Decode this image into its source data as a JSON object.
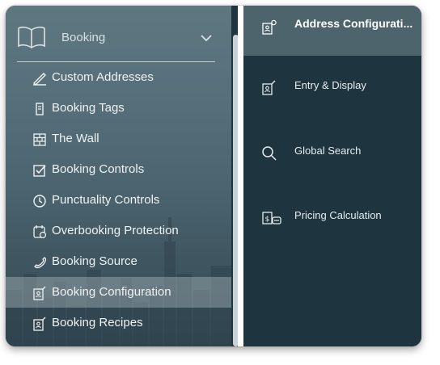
{
  "colors": {
    "left_panel": "#566e79",
    "right_panel": "#1e3540",
    "active_left": "#8fa0a8",
    "active_right": "#4d646d",
    "text": "#eef2f3"
  },
  "left_panel": {
    "header": {
      "title": "Booking",
      "icon": "book-open-icon",
      "toggle_icon": "chevron-down-icon"
    },
    "items": [
      {
        "label": "Custom Addresses",
        "icon": "pen-edit-icon"
      },
      {
        "label": "Booking Tags",
        "icon": "tag-icon"
      },
      {
        "label": "The Wall",
        "icon": "brick-wall-icon"
      },
      {
        "label": "Booking Controls",
        "icon": "checkbox-icon"
      },
      {
        "label": "Punctuality Controls",
        "icon": "clock-icon"
      },
      {
        "label": "Overbooking Protection",
        "icon": "calendar-clock-icon"
      },
      {
        "label": "Booking Source",
        "icon": "phone-icon"
      },
      {
        "label": "Booking Configuration",
        "icon": "config-doc-icon",
        "active": true
      },
      {
        "label": "Booking Recipes",
        "icon": "recipe-doc-icon"
      }
    ]
  },
  "right_panel": {
    "items": [
      {
        "label": "Address Configurati...",
        "icon": "address-config-icon",
        "active": true
      },
      {
        "label": "Entry & Display",
        "icon": "entry-display-icon"
      },
      {
        "label": "Global Search",
        "icon": "search-icon"
      },
      {
        "label": "Pricing Calculation",
        "icon": "pricing-icon"
      }
    ]
  }
}
